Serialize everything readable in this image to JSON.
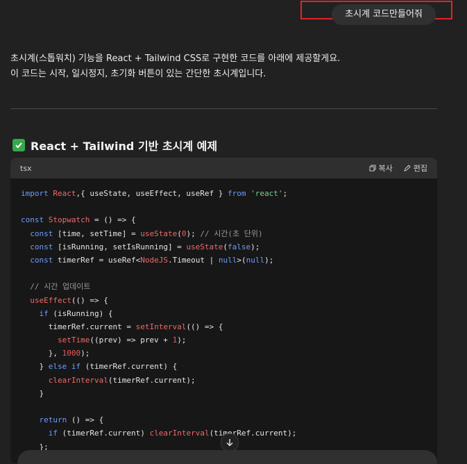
{
  "user_message": "초시계 코드만들어줘",
  "intro": {
    "line1": "초시계(스톱워치) 기능을 React + Tailwind CSS로 구현한 코드를 아래에 제공할게요.",
    "line2": "이 코드는 시작, 일시정지, 초기화 버튼이 있는 간단한 초시계입니다."
  },
  "section_title": "React + Tailwind 기반 초시계 예제",
  "code_block": {
    "language": "tsx",
    "copy_label": "복사",
    "edit_label": "편집",
    "lines": [
      [
        [
          "kw",
          "import "
        ],
        [
          "fn",
          "React"
        ],
        [
          "",
          ","
        ],
        [
          "",
          "{ useState, useEffect, useRef } "
        ],
        [
          "kw",
          "from "
        ],
        [
          "str",
          "'react'"
        ],
        [
          "",
          ";"
        ]
      ],
      [],
      [
        [
          "kw",
          "const "
        ],
        [
          "fn",
          "Stopwatch"
        ],
        [
          "",
          " = () => {"
        ]
      ],
      [
        [
          "",
          "  "
        ],
        [
          "kw",
          "const "
        ],
        [
          "",
          "[time, setTime] = "
        ],
        [
          "fn",
          "useState"
        ],
        [
          "",
          "("
        ],
        [
          "num",
          "0"
        ],
        [
          "",
          "); "
        ],
        [
          "cm",
          "// 시간(초 단위)"
        ]
      ],
      [
        [
          "",
          "  "
        ],
        [
          "kw",
          "const "
        ],
        [
          "",
          "[isRunning, setIsRunning] = "
        ],
        [
          "fn",
          "useState"
        ],
        [
          "",
          "("
        ],
        [
          "kw",
          "false"
        ],
        [
          "",
          ");"
        ]
      ],
      [
        [
          "",
          "  "
        ],
        [
          "kw",
          "const "
        ],
        [
          "",
          "timerRef = useRef<"
        ],
        [
          "fn",
          "NodeJS"
        ],
        [
          "",
          ".Timeout | "
        ],
        [
          "kw",
          "null"
        ],
        [
          "",
          ">("
        ],
        [
          "kw",
          "null"
        ],
        [
          "",
          ");"
        ]
      ],
      [],
      [
        [
          "",
          "  "
        ],
        [
          "cm",
          "// 시간 업데이트"
        ]
      ],
      [
        [
          "",
          "  "
        ],
        [
          "fn",
          "useEffect"
        ],
        [
          "",
          "(() => {"
        ]
      ],
      [
        [
          "",
          "    "
        ],
        [
          "kw",
          "if "
        ],
        [
          "",
          "(isRunning) {"
        ]
      ],
      [
        [
          "",
          "      timerRef.current = "
        ],
        [
          "fn",
          "setInterval"
        ],
        [
          "",
          "(() => {"
        ]
      ],
      [
        [
          "",
          "        "
        ],
        [
          "fn",
          "setTime"
        ],
        [
          "",
          "((prev) => prev + "
        ],
        [
          "num",
          "1"
        ],
        [
          "",
          ");"
        ]
      ],
      [
        [
          "",
          "      }, "
        ],
        [
          "num",
          "1000"
        ],
        [
          "",
          ");"
        ]
      ],
      [
        [
          "",
          "    } "
        ],
        [
          "kw",
          "else if "
        ],
        [
          "",
          "(timerRef.current) {"
        ]
      ],
      [
        [
          "",
          "      "
        ],
        [
          "fn",
          "clearInterval"
        ],
        [
          "",
          "(timerRef.current);"
        ]
      ],
      [
        [
          "",
          "    }"
        ]
      ],
      [],
      [
        [
          "",
          "    "
        ],
        [
          "kw",
          "return "
        ],
        [
          "",
          "() => {"
        ]
      ],
      [
        [
          "",
          "      "
        ],
        [
          "kw",
          "if "
        ],
        [
          "",
          "(timerRef.current) "
        ],
        [
          "fn",
          "clearInterval"
        ],
        [
          "",
          "(timerRef.current);"
        ]
      ],
      [
        [
          "",
          "    };"
        ]
      ]
    ]
  },
  "icons": {
    "check": "check-icon",
    "copy": "copy-icon",
    "edit": "edit-icon",
    "scroll_down": "arrow-down-icon"
  },
  "colors": {
    "background": "#212121",
    "code_background": "#171717",
    "highlight_border": "#e0242a",
    "check_green": "#39a74c"
  }
}
